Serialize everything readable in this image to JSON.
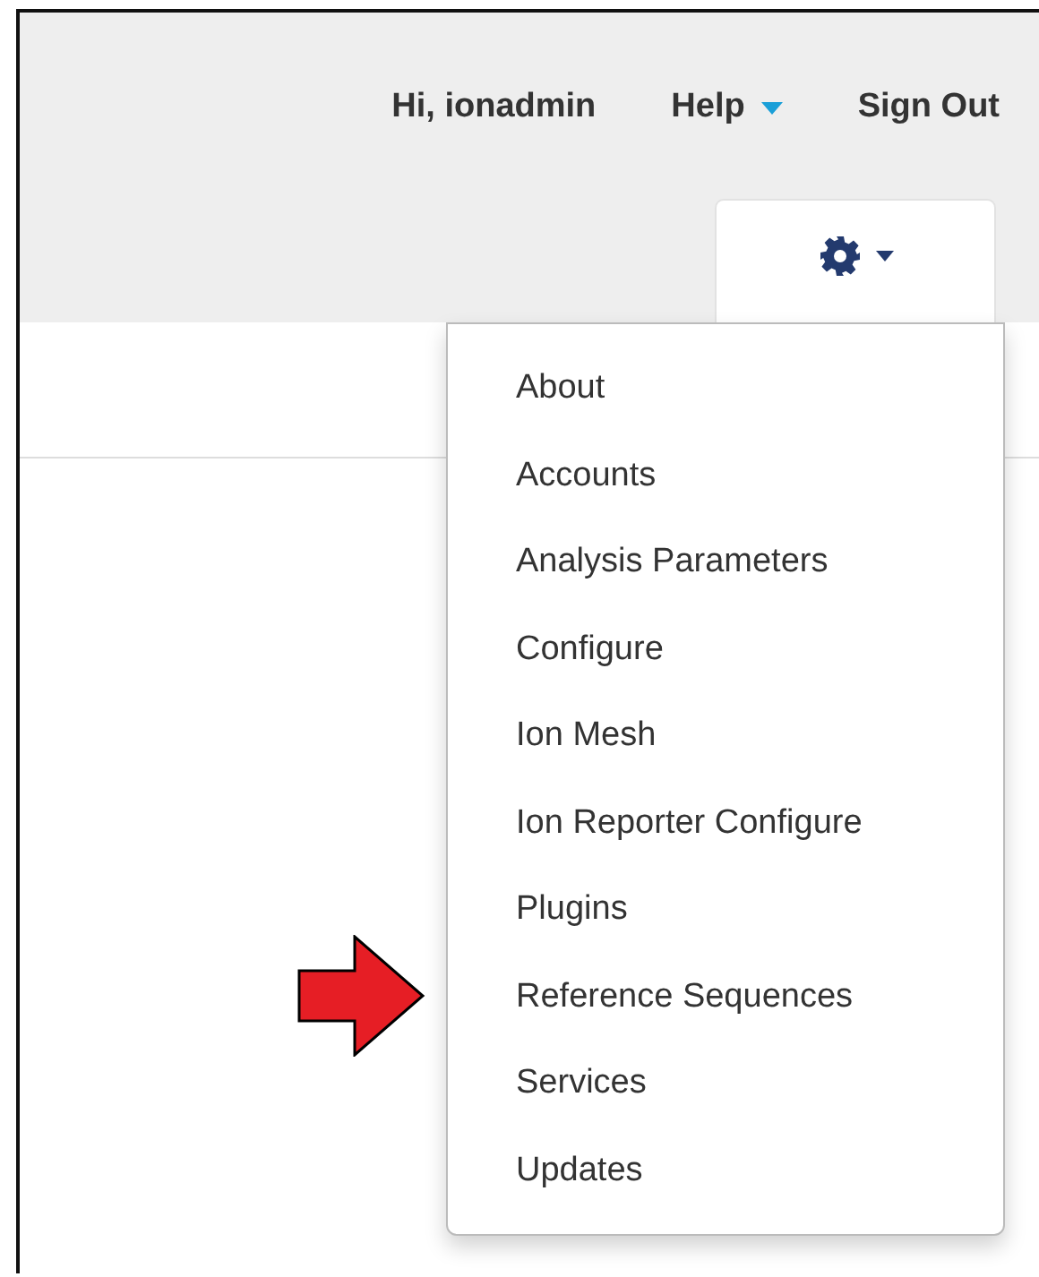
{
  "header": {
    "greeting": "Hi, ionadmin",
    "help": "Help",
    "sign_out": "Sign Out"
  },
  "settings_menu": {
    "expanded": true,
    "items": [
      "About",
      "Accounts",
      "Analysis Parameters",
      "Configure",
      "Ion Mesh",
      "Ion Reporter Configure",
      "Plugins",
      "Reference Sequences",
      "Services",
      "Updates"
    ]
  }
}
